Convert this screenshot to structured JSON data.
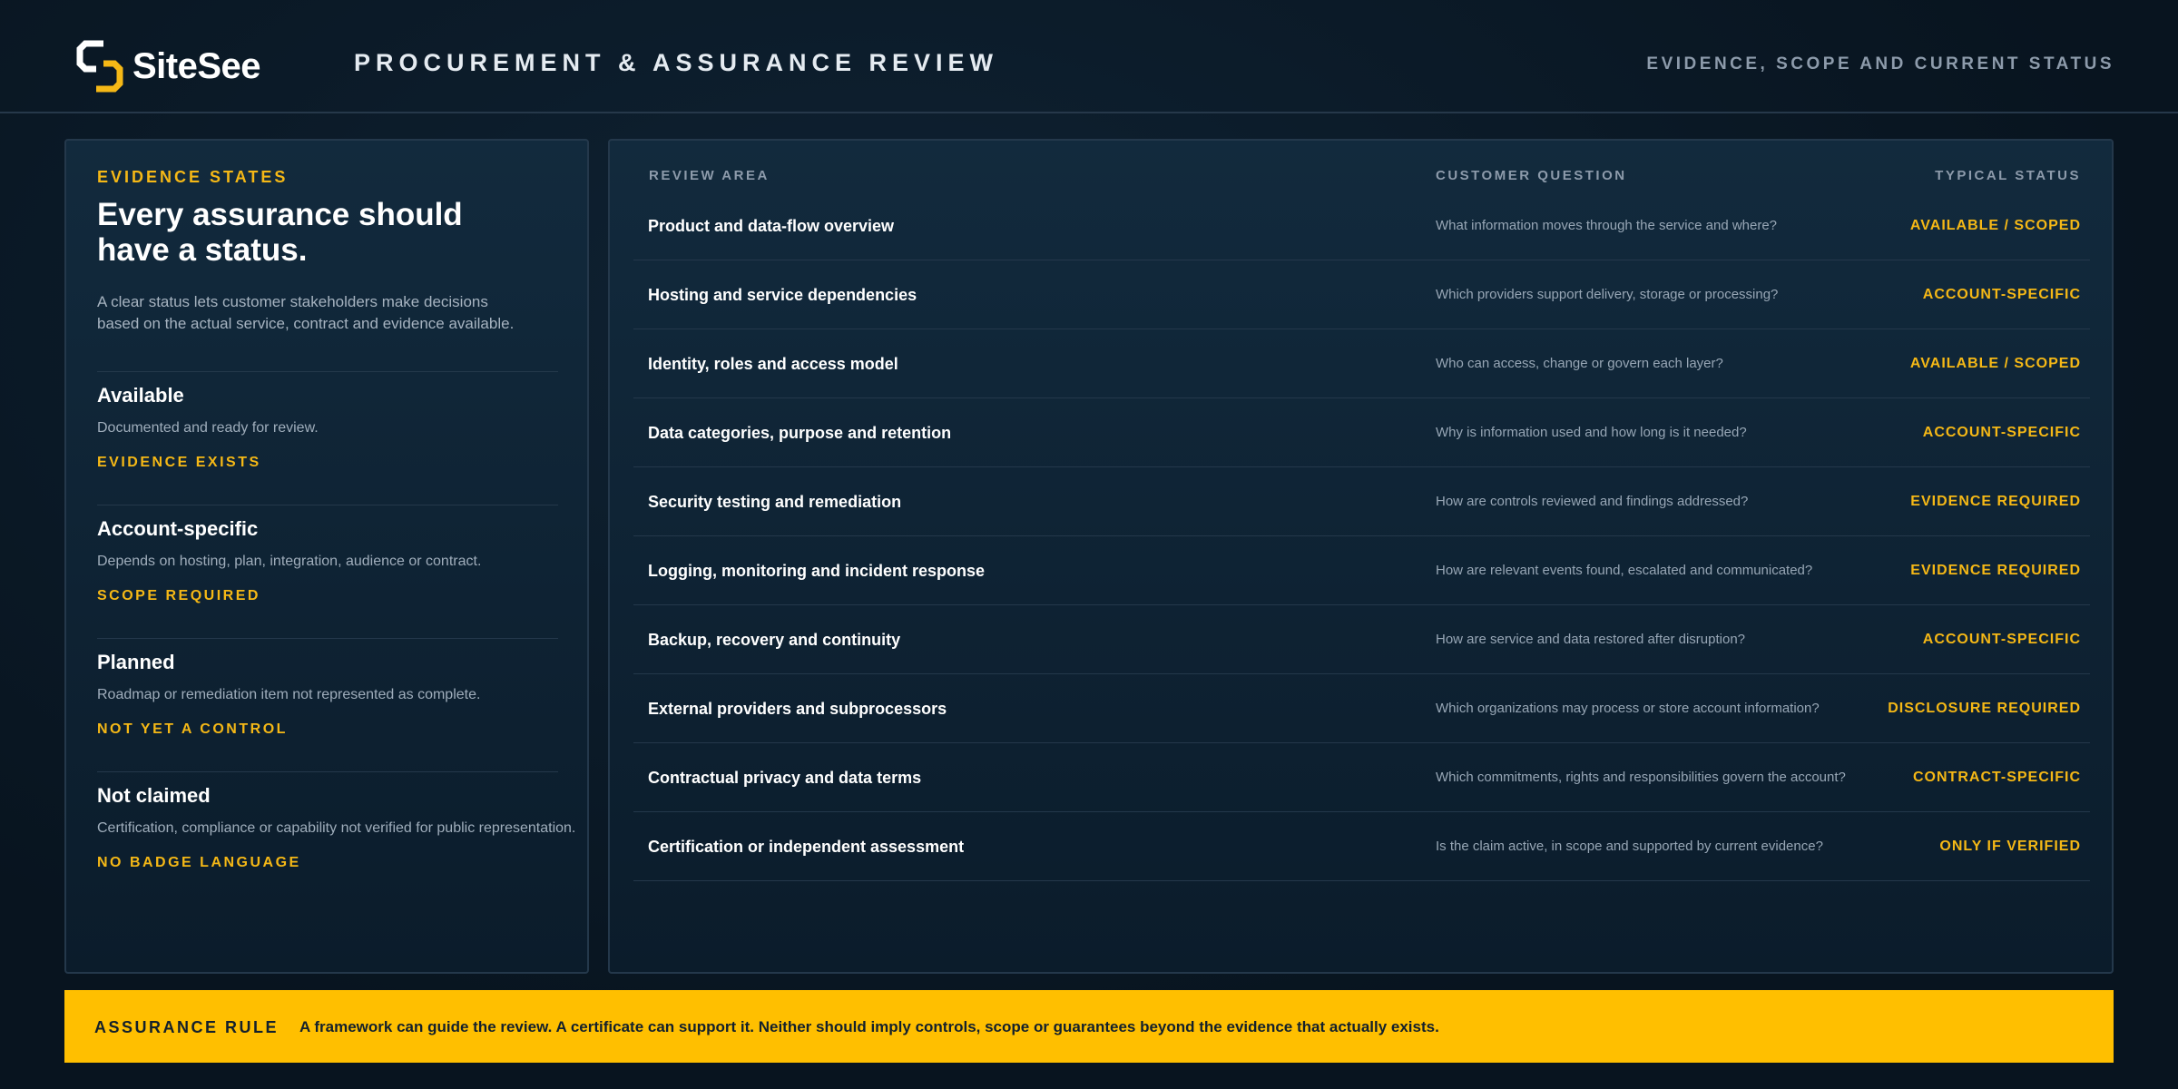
{
  "header": {
    "logo_text": "SiteSee",
    "title": "PROCUREMENT & ASSURANCE REVIEW",
    "subtitle": "EVIDENCE, SCOPE AND CURRENT STATUS"
  },
  "left_panel": {
    "eyebrow": "EVIDENCE STATES",
    "heading": "Every assurance should have a status.",
    "intro": "A clear status lets customer stakeholders make decisions based on the actual service, contract and evidence available.",
    "states": [
      {
        "title": "Available",
        "desc": "Documented and ready for review.",
        "tag": "EVIDENCE EXISTS"
      },
      {
        "title": "Account-specific",
        "desc": "Depends on hosting, plan, integration, audience or contract.",
        "tag": "SCOPE REQUIRED"
      },
      {
        "title": "Planned",
        "desc": "Roadmap or remediation item not represented as complete.",
        "tag": "NOT YET A CONTROL"
      },
      {
        "title": "Not claimed",
        "desc": "Certification, compliance or capability not verified for public representation.",
        "tag": "NO BADGE LANGUAGE"
      }
    ]
  },
  "table": {
    "headers": {
      "area": "REVIEW AREA",
      "question": "CUSTOMER QUESTION",
      "status": "TYPICAL STATUS"
    },
    "rows": [
      {
        "area": "Product and data-flow overview",
        "question": "What information moves through the service and where?",
        "status": "AVAILABLE / SCOPED"
      },
      {
        "area": "Hosting and service dependencies",
        "question": "Which providers support delivery, storage or processing?",
        "status": "ACCOUNT-SPECIFIC"
      },
      {
        "area": "Identity, roles and access model",
        "question": "Who can access, change or govern each layer?",
        "status": "AVAILABLE / SCOPED"
      },
      {
        "area": "Data categories, purpose and retention",
        "question": "Why is information used and how long is it needed?",
        "status": "ACCOUNT-SPECIFIC"
      },
      {
        "area": "Security testing and remediation",
        "question": "How are controls reviewed and findings addressed?",
        "status": "EVIDENCE REQUIRED"
      },
      {
        "area": "Logging, monitoring and incident response",
        "question": "How are relevant events found, escalated and communicated?",
        "status": "EVIDENCE REQUIRED"
      },
      {
        "area": "Backup, recovery and continuity",
        "question": "How are service and data restored after disruption?",
        "status": "ACCOUNT-SPECIFIC"
      },
      {
        "area": "External providers and subprocessors",
        "question": "Which organizations may process or store account information?",
        "status": "DISCLOSURE REQUIRED"
      },
      {
        "area": "Contractual privacy and data terms",
        "question": "Which commitments, rights and responsibilities govern the account?",
        "status": "CONTRACT-SPECIFIC"
      },
      {
        "area": "Certification or independent assessment",
        "question": "Is the claim active, in scope and supported by current evidence?",
        "status": "ONLY IF VERIFIED"
      }
    ]
  },
  "rule": {
    "label": "ASSURANCE RULE",
    "text": "A framework can guide the review. A certificate can support it. Neither should imply controls, scope or guarantees beyond the evidence that actually exists."
  },
  "colors": {
    "accent": "#f5b816",
    "background": "#0a1826",
    "rule_bar": "#ffbf00"
  },
  "icons": {
    "logo": "sitesee-logo-icon"
  }
}
